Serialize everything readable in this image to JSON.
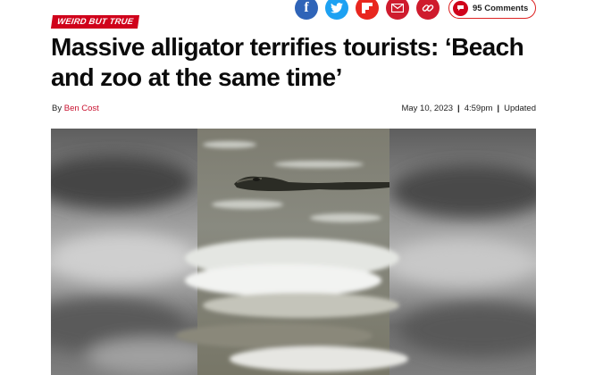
{
  "article": {
    "kicker": "WEIRD BUT TRUE",
    "title": "Massive alligator terrifies tourists: ‘Beach and zoo at the same time’",
    "byline_prefix": "By",
    "author": "Ben Cost",
    "date": "May 10, 2023",
    "time": "4:59pm",
    "updated": "Updated"
  },
  "share": {
    "icons": [
      "facebook-icon",
      "twitter-icon",
      "flipboard-icon",
      "email-icon",
      "link-icon"
    ],
    "comments_label": "95 Comments"
  },
  "colors": {
    "brand_red": "#d0021b",
    "facebook": "#2f64b8",
    "twitter": "#1da1f2"
  },
  "media": {
    "type": "video-frame",
    "subject": "alligator-in-surf"
  }
}
